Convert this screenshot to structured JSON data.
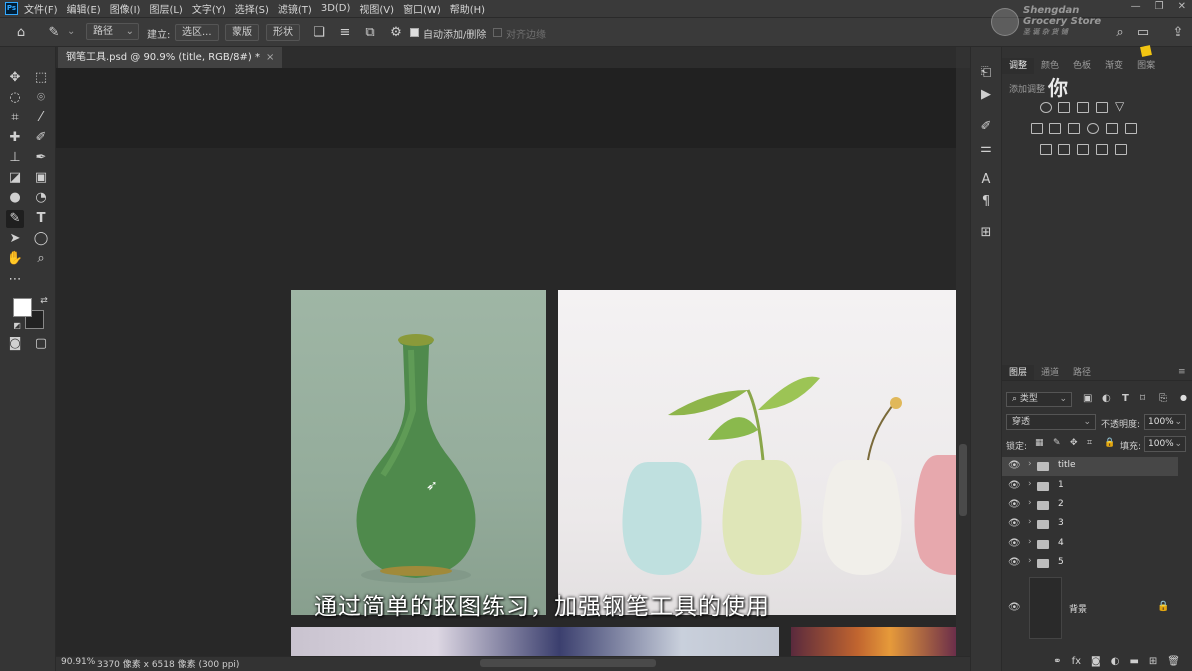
{
  "app": {
    "logo_text": "Ps"
  },
  "menu": [
    "文件(F)",
    "编辑(E)",
    "图像(I)",
    "图层(L)",
    "文字(Y)",
    "选择(S)",
    "滤镜(T)",
    "3D(D)",
    "视图(V)",
    "窗口(W)",
    "帮助(H)"
  ],
  "window_controls": {
    "minimize": "—",
    "restore": "❐",
    "close": "✕"
  },
  "options_bar": {
    "mode_select": "路径",
    "make_label": "建立:",
    "selection_button": "选区...",
    "mask_button": "蒙版",
    "shape_button": "形状",
    "auto_add_delete_label": "自动添加/删除",
    "align_edges_label": "对齐边缘"
  },
  "document": {
    "tab_title": "钢笔工具.psd @ 90.9% (title, RGB/8#) *",
    "close_glyph": "×",
    "subtitle": "通过简单的抠图练习，加强钢笔工具的使用"
  },
  "status": {
    "zoom": "90.91%",
    "size": "3370 像素 x 6518 像素 (300 ppi)"
  },
  "watermark": {
    "line1": "Shengdan",
    "line2": "Grocery Store",
    "line3": "圣 诞 杂 货 铺"
  },
  "floating_glyph": "你",
  "adjustments": {
    "tabs": [
      "调整",
      "颜色",
      "色板",
      "渐变",
      "图案"
    ],
    "add_label": "添加调整"
  },
  "layers_panel": {
    "tabs": [
      "图层",
      "通道",
      "路径"
    ],
    "filter_select": "类型",
    "blend_mode": "穿透",
    "opacity_label": "不透明度:",
    "opacity_value": "100%",
    "lock_label": "锁定:",
    "fill_label": "填充:",
    "fill_value": "100%",
    "groups": [
      {
        "name": "title",
        "selected": true
      },
      {
        "name": "1",
        "selected": false
      },
      {
        "name": "2",
        "selected": false
      },
      {
        "name": "3",
        "selected": false
      },
      {
        "name": "4",
        "selected": false
      },
      {
        "name": "5",
        "selected": false
      }
    ],
    "background_layer": "背景"
  },
  "colors": {
    "foreground": "#ffffff",
    "background": "#222222",
    "accent": "#31a8ff"
  }
}
